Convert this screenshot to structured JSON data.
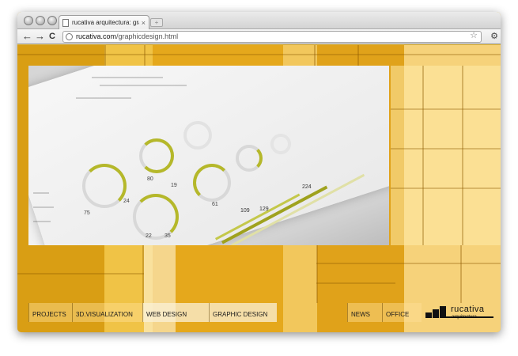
{
  "browser": {
    "tab_title": "rucativa arquitectura: graph",
    "tab_close": "×",
    "new_tab": "+",
    "url_host": "rucativa.com",
    "url_path": "/graphicdesign.html",
    "back": "←",
    "forward": "→",
    "reload": "C",
    "star": "☆",
    "wrench": "🔧"
  },
  "menu": {
    "items": [
      {
        "label": "PROJECTS"
      },
      {
        "label": "3D.VISUALIZATION"
      },
      {
        "label": "WEB DESIGN"
      },
      {
        "label": "GRAPHIC DESIGN"
      },
      {
        "label": "NEWS"
      },
      {
        "label": "OFFICE"
      }
    ]
  },
  "logo": {
    "name": "rucativa",
    "sub": "arquitectura"
  },
  "photo": {
    "numbers": [
      "75",
      "80",
      "24",
      "19",
      "22",
      "35",
      "61",
      "109",
      "129",
      "224"
    ]
  },
  "colors": {
    "accent_green": "#b5b82a",
    "accent_bar": "#c4c84a",
    "brand_yellow": "#e3b73a"
  }
}
